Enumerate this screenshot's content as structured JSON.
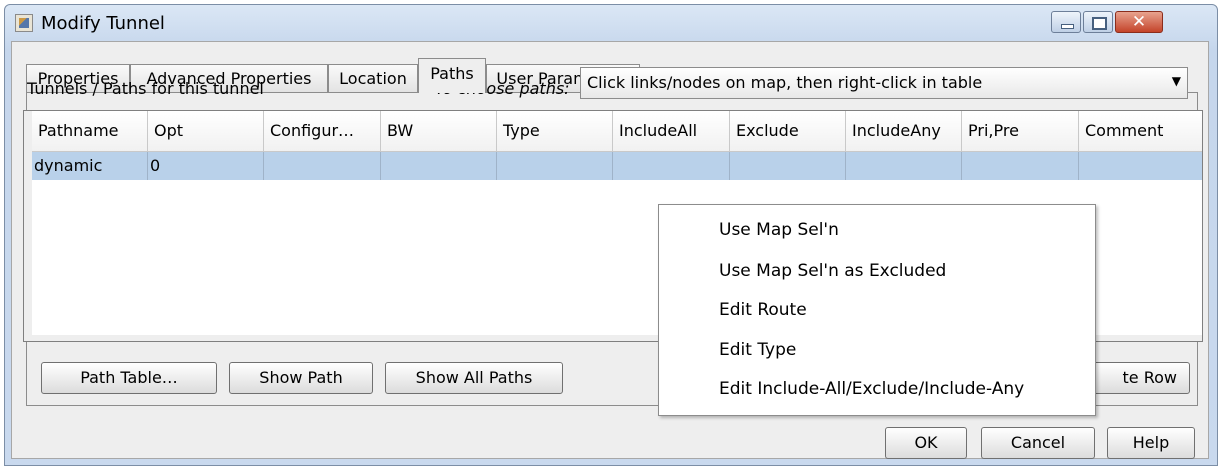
{
  "window": {
    "title": "Modify Tunnel",
    "close_glyph": "✕"
  },
  "tabs": [
    {
      "label": "Properties"
    },
    {
      "label": "Advanced Properties"
    },
    {
      "label": "Location"
    },
    {
      "label": "Paths",
      "active": true
    },
    {
      "label": "User Parameters"
    }
  ],
  "paths_panel": {
    "section_label": "Tunnels / Paths for this tunnel",
    "choose_label": "To choose paths:",
    "choose_value": "Click links/nodes on map, then right-click in table"
  },
  "table": {
    "columns": [
      "Pathname",
      "Opt",
      "Configur…",
      "BW",
      "Type",
      "IncludeAll",
      "Exclude",
      "IncludeAny",
      "Pri,Pre",
      "Comment"
    ],
    "rows": [
      [
        "dynamic",
        "0",
        "",
        "",
        "",
        "",
        "",
        "",
        "",
        ""
      ]
    ]
  },
  "buttons": {
    "path_table": "Path Table…",
    "show_path": "Show Path",
    "show_all_paths": "Show All Paths",
    "delete_row_partial": "te Row",
    "ok": "OK",
    "cancel": "Cancel",
    "help": "Help"
  },
  "context_menu": {
    "items": [
      "Use Map Sel'n",
      "Use Map Sel'n as Excluded",
      "Edit Route",
      "Edit Type",
      "Edit Include-All/Exclude/Include-Any"
    ]
  },
  "icons": {
    "app": "java-cup-icon",
    "minimize": "minimize-icon",
    "maximize": "maximize-icon",
    "close": "close-icon",
    "dropdown": "chevron-down-icon"
  }
}
